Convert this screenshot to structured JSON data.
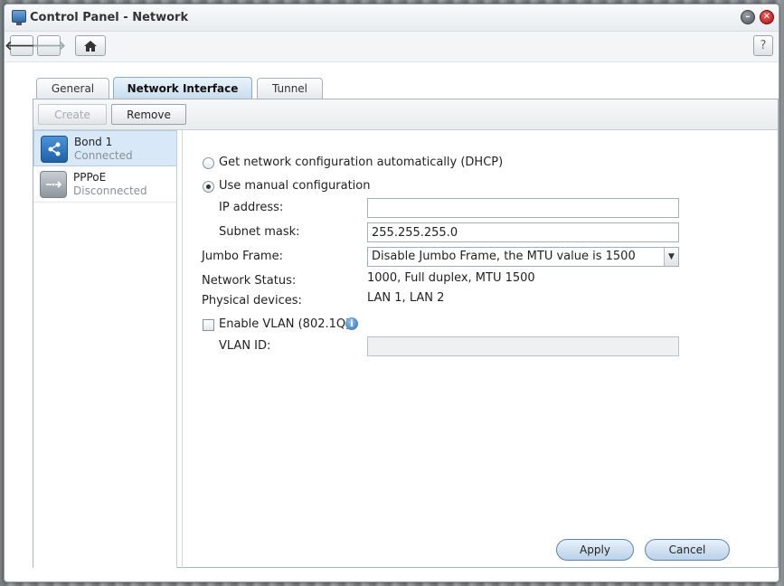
{
  "window": {
    "title": "Control Panel - Network"
  },
  "toolbar": {
    "back_icon": "arrow-left-icon",
    "forward_icon": "arrow-right-icon",
    "home_icon": "home-icon",
    "help_label": "?"
  },
  "tabs": [
    {
      "label": "General",
      "active": false
    },
    {
      "label": "Network Interface",
      "active": true
    },
    {
      "label": "Tunnel",
      "active": false
    }
  ],
  "panel_toolbar": {
    "create_label": "Create",
    "remove_label": "Remove"
  },
  "interfaces": [
    {
      "name": "Bond 1",
      "status": "Connected",
      "selected": true
    },
    {
      "name": "PPPoE",
      "status": "Disconnected",
      "selected": false
    }
  ],
  "form": {
    "dhcp_label": "Get network configuration automatically (DHCP)",
    "manual_label": "Use manual configuration",
    "ip_label": "IP address:",
    "ip_value": "",
    "subnet_label": "Subnet mask:",
    "subnet_value": "255.255.255.0",
    "jumbo_label": "Jumbo Frame:",
    "jumbo_value": "Disable Jumbo Frame, the MTU value is 1500",
    "status_label": "Network Status:",
    "status_value": "1000, Full duplex, MTU 1500",
    "physical_label": "Physical devices:",
    "physical_value": "LAN 1, LAN 2",
    "vlan_label": "Enable VLAN (802.1Q)",
    "vlan_id_label": "VLAN ID:",
    "vlan_id_value": ""
  },
  "actions": {
    "apply_label": "Apply",
    "cancel_label": "Cancel"
  },
  "colors": {
    "accent": "#2f6aa8",
    "selection": "#d9e8f6"
  }
}
